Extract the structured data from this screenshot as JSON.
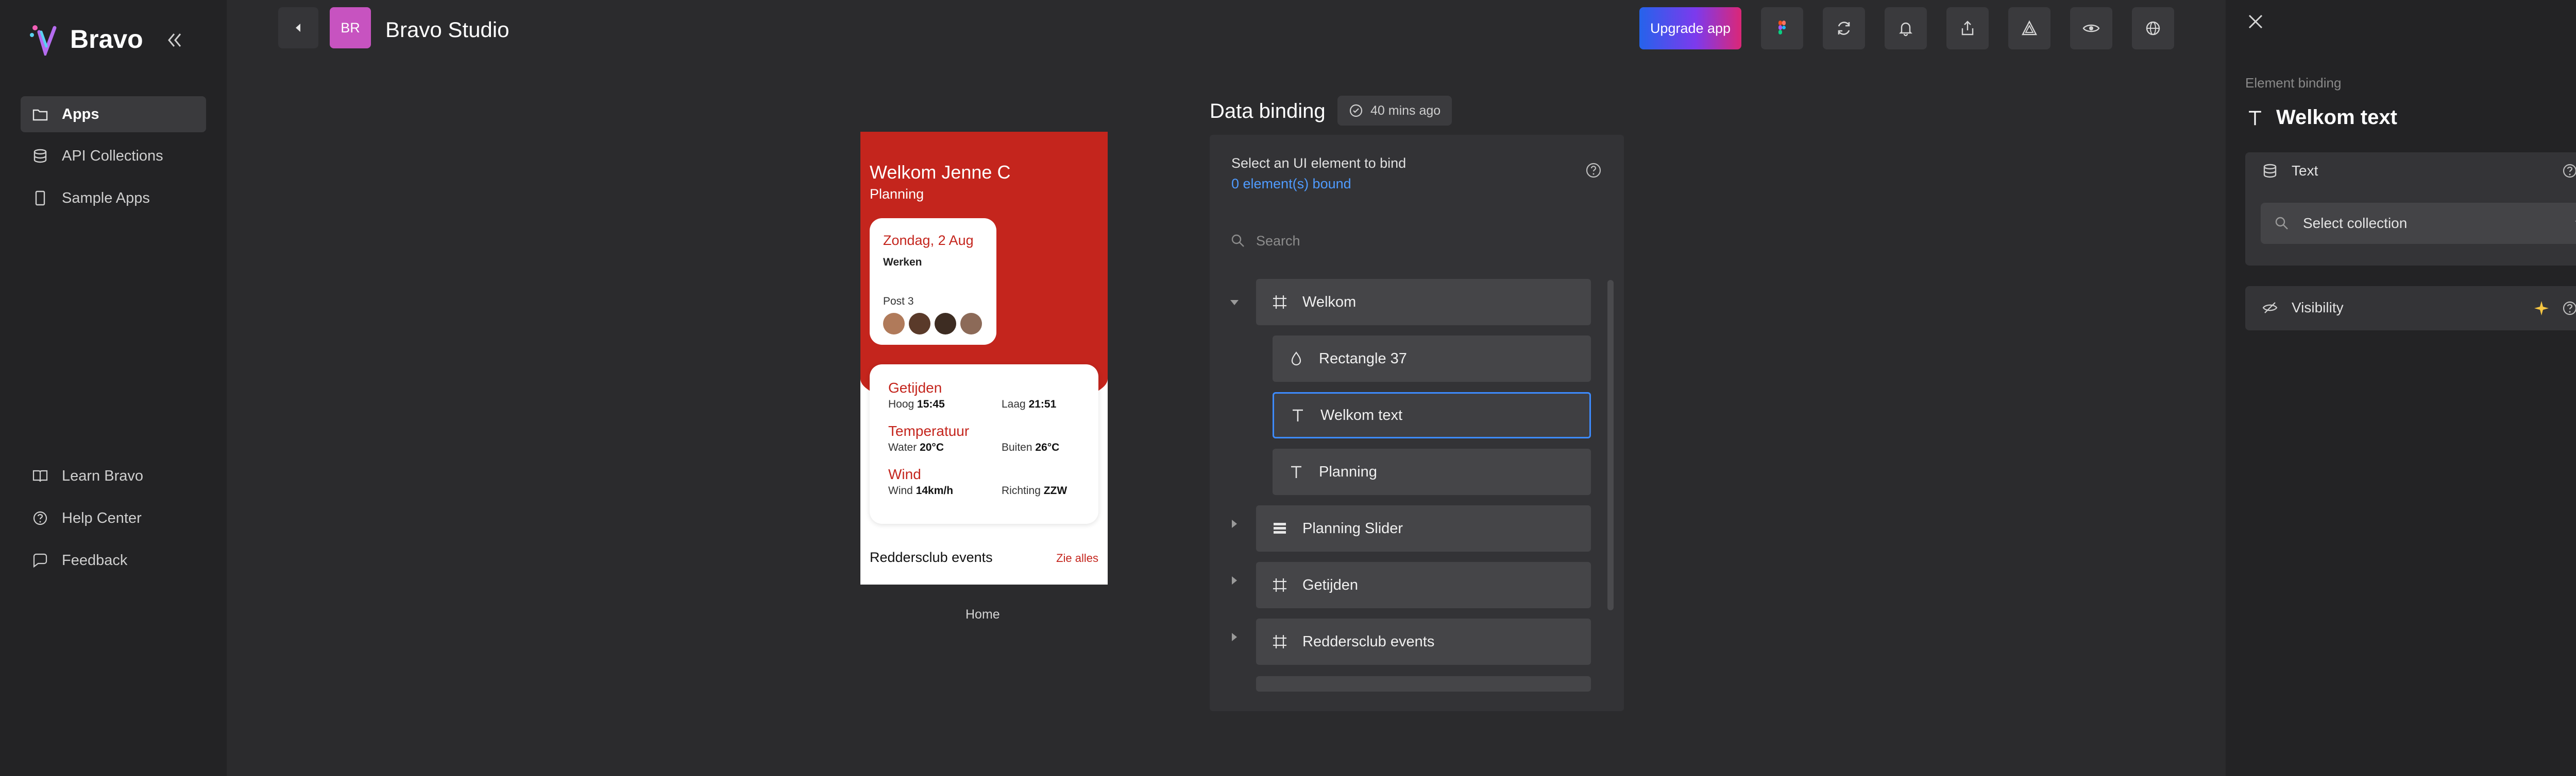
{
  "app": {
    "brand": "Bravo",
    "title": "Bravo Studio",
    "avatar_initials": "BR"
  },
  "sidebar": {
    "items": [
      {
        "label": "Apps",
        "icon": "folder-icon"
      },
      {
        "label": "API Collections",
        "icon": "database-icon"
      },
      {
        "label": "Sample Apps",
        "icon": "phone-icon"
      }
    ],
    "bottom_items": [
      {
        "label": "Learn Bravo",
        "icon": "book-icon"
      },
      {
        "label": "Help Center",
        "icon": "help-icon"
      },
      {
        "label": "Feedback",
        "icon": "chat-icon"
      }
    ]
  },
  "toolbar": {
    "upgrade_label": "Upgrade app"
  },
  "preview": {
    "welcome": "Welkom Jenne C",
    "subtitle": "Planning",
    "card_date": "Zondag, 2 Aug",
    "card_work": "Werken",
    "card_post": "Post 3",
    "tides_title": "Getijden",
    "tides_high_label": "Hoog",
    "tides_high_value": "15:45",
    "tides_low_label": "Laag",
    "tides_low_value": "21:51",
    "temp_title": "Temperatuur",
    "temp_water_label": "Water",
    "temp_water_value": "20°C",
    "temp_out_label": "Buiten",
    "temp_out_value": "26°C",
    "wind_title": "Wind",
    "wind_label": "Wind",
    "wind_value": "14km/h",
    "dir_label": "Richting",
    "dir_value": "ZZW",
    "events_title": "Reddersclub events",
    "see_all": "Zie alles",
    "screen_name": "Home"
  },
  "data_binding": {
    "title": "Data binding",
    "saved": "40 mins ago",
    "hint": "Select an UI element to bind",
    "bound": "0 element(s) bound",
    "search_placeholder": "Search",
    "layers": [
      {
        "label": "Welkom",
        "icon": "frame-icon"
      },
      {
        "label": "Rectangle 37",
        "icon": "drop-icon"
      },
      {
        "label": "Welkom text",
        "icon": "text-icon"
      },
      {
        "label": "Planning",
        "icon": "text-icon"
      },
      {
        "label": "Planning Slider",
        "icon": "list-icon"
      },
      {
        "label": "Getijden",
        "icon": "frame-icon"
      },
      {
        "label": "Reddersclub events",
        "icon": "frame-icon"
      }
    ]
  },
  "element_binding": {
    "section": "Element binding",
    "element": "Welkom text",
    "text_label": "Text",
    "select_collection": "Select collection",
    "visibility_label": "Visibility"
  },
  "colors": {
    "brand_red": "#c4251d",
    "accent_blue": "#3d8bff",
    "avatar": "#c753c0"
  }
}
